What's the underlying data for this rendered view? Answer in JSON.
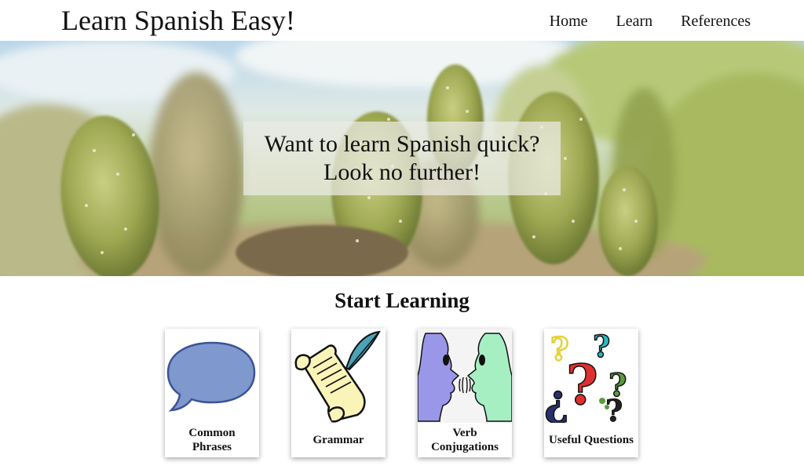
{
  "header": {
    "site_title": "Learn Spanish Easy!",
    "nav": [
      {
        "label": "Home"
      },
      {
        "label": "Learn"
      },
      {
        "label": "References"
      }
    ]
  },
  "hero": {
    "line1": "Want to learn Spanish quick?",
    "line2": "Look no further!"
  },
  "section": {
    "title": "Start Learning"
  },
  "cards": [
    {
      "label": "Common Phrases",
      "icon": "speech-bubble-icon"
    },
    {
      "label": "Grammar",
      "icon": "scroll-quill-icon"
    },
    {
      "label": "Verb Conjugations",
      "icon": "talking-faces-icon"
    },
    {
      "label": "Useful Questions",
      "icon": "question-marks-icon"
    }
  ]
}
